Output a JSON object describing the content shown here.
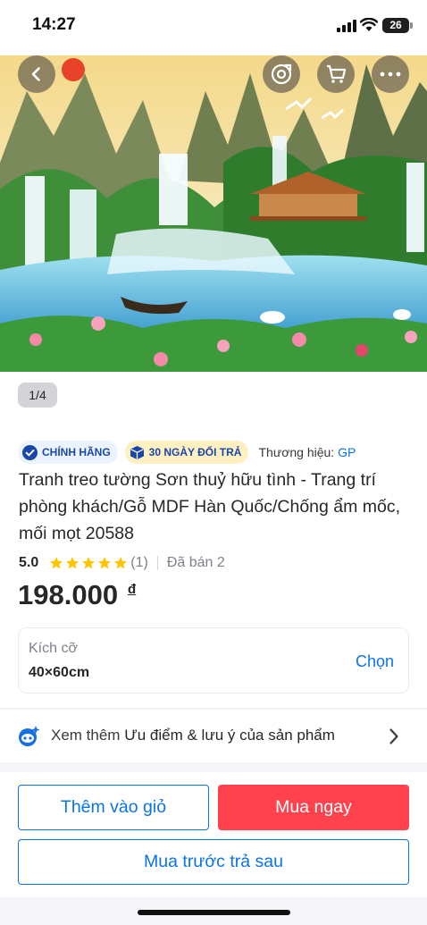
{
  "status_bar": {
    "time": "14:27",
    "battery": "26"
  },
  "gallery": {
    "counter": "1/4",
    "icons": [
      "back-icon",
      "share-icon",
      "cart-icon",
      "more-icon"
    ]
  },
  "badges": {
    "genuine": "CHÍNH HÃNG",
    "return": "30 NGÀY ĐỔI TRẢ"
  },
  "brand": {
    "label": "Thương hiệu:",
    "name": "GP"
  },
  "product": {
    "title": "Tranh treo tường Sơn thuỷ hữu tình - Trang trí phòng khách/Gỗ MDF Hàn Quốc/Chống ẩm mốc, mối mọt 20588",
    "rating": "5.0",
    "stars": 5,
    "rating_count": "(1)",
    "sold": "Đã bán 2",
    "price": "198.000",
    "currency": "đ"
  },
  "size_selector": {
    "label": "Kích cỡ",
    "value": "40×60cm",
    "action": "Chọn"
  },
  "more_info": {
    "prefix": "Xem thêm",
    "highlight": "Ưu điểm & lưu ý của sản phẩm"
  },
  "actions": {
    "add_to_cart": "Thêm vào giỏ",
    "buy_now": "Mua ngay",
    "buy_now_pay_later": "Mua trước trả sau"
  },
  "colors": {
    "primary_blue": "#0b74e5",
    "buy_red": "#ff424e",
    "star_yellow": "#ffc400"
  }
}
